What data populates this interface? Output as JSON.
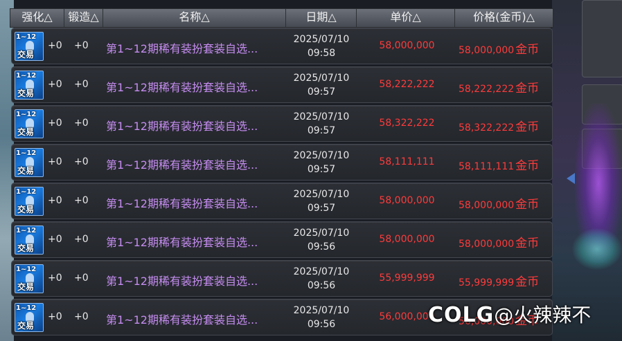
{
  "table": {
    "headers": {
      "enhance": "强化△",
      "forge": "锻造△",
      "name": "名称△",
      "date": "日期△",
      "unit_price": "单价△",
      "price": "价格(金币)△"
    },
    "rows": [
      {
        "enhance": "+0",
        "forge": "+0",
        "name": "第1~12期稀有装扮套装自选...",
        "date": "2025/07/10",
        "time": "09:58",
        "unit_price": "58,000,000",
        "price": "58,000,000",
        "currency": "金币",
        "icon": {
          "level": "1~12",
          "tag": "交易"
        }
      },
      {
        "enhance": "+0",
        "forge": "+0",
        "name": "第1~12期稀有装扮套装自选...",
        "date": "2025/07/10",
        "time": "09:57",
        "unit_price": "58,222,222",
        "price": "58,222,222",
        "currency": "金币",
        "icon": {
          "level": "1~12",
          "tag": "交易"
        }
      },
      {
        "enhance": "+0",
        "forge": "+0",
        "name": "第1~12期稀有装扮套装自选...",
        "date": "2025/07/10",
        "time": "09:57",
        "unit_price": "58,322,222",
        "price": "58,322,222",
        "currency": "金币",
        "icon": {
          "level": "1~12",
          "tag": "交易"
        }
      },
      {
        "enhance": "+0",
        "forge": "+0",
        "name": "第1~12期稀有装扮套装自选...",
        "date": "2025/07/10",
        "time": "09:57",
        "unit_price": "58,111,111",
        "price": "58,111,111",
        "currency": "金币",
        "icon": {
          "level": "1~12",
          "tag": "交易"
        }
      },
      {
        "enhance": "+0",
        "forge": "+0",
        "name": "第1~12期稀有装扮套装自选...",
        "date": "2025/07/10",
        "time": "09:57",
        "unit_price": "58,000,000",
        "price": "58,000,000",
        "currency": "金币",
        "icon": {
          "level": "1~12",
          "tag": "交易"
        }
      },
      {
        "enhance": "+0",
        "forge": "+0",
        "name": "第1~12期稀有装扮套装自选...",
        "date": "2025/07/10",
        "time": "09:56",
        "unit_price": "58,000,000",
        "price": "58,000,000",
        "currency": "金币",
        "icon": {
          "level": "1~12",
          "tag": "交易"
        }
      },
      {
        "enhance": "+0",
        "forge": "+0",
        "name": "第1~12期稀有装扮套装自选...",
        "date": "2025/07/10",
        "time": "09:56",
        "unit_price": "55,999,999",
        "price": "55,999,999",
        "currency": "金币",
        "icon": {
          "level": "1~12",
          "tag": "交易"
        }
      },
      {
        "enhance": "+0",
        "forge": "+0",
        "name": "第1~12期稀有装扮套装自选...",
        "date": "2025/07/10",
        "time": "09:56",
        "unit_price": "56,000,000",
        "price": "56,000,000",
        "currency": "金币",
        "icon": {
          "level": "1~12",
          "tag": "交易"
        }
      }
    ]
  },
  "watermark": {
    "logo": "COLG",
    "author": "@火辣辣不"
  },
  "colors": {
    "price": "#ff3b3b",
    "item_name": "#c58cf0",
    "header_bg": "#55595f"
  }
}
